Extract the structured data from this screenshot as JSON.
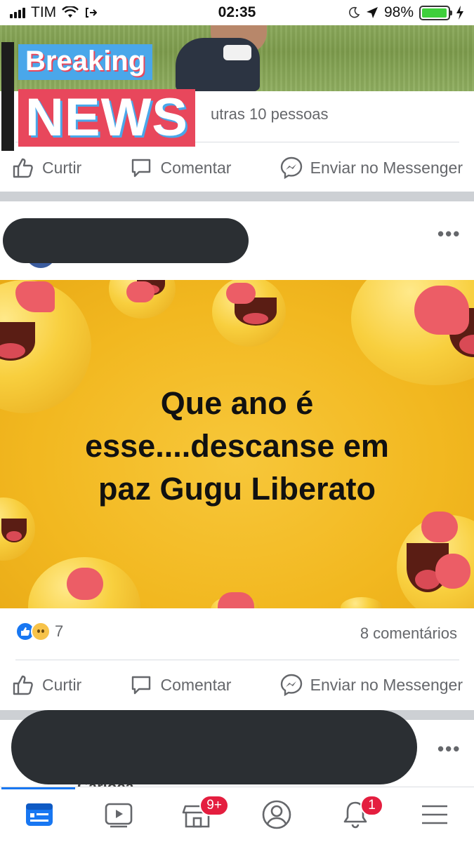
{
  "status_bar": {
    "carrier": "TIM",
    "time": "02:35",
    "battery_percent": "98%",
    "battery_level": 0.98,
    "icons": [
      "signal-icon",
      "wifi-icon",
      "call-forwarding-icon",
      "moon-icon",
      "location-arrow-icon",
      "battery-icon",
      "charging-icon"
    ]
  },
  "post1": {
    "overlay": {
      "top": "Breaking",
      "bottom": "NEWS"
    },
    "likes_text": "utras 10 pessoas",
    "actions": {
      "like": "Curtir",
      "comment": "Comentar",
      "messenger": "Enviar no Messenger"
    }
  },
  "post2": {
    "more": "•••",
    "image_text": [
      "Que ano é",
      "esse....descanse em",
      "paz Gugu Liberato"
    ],
    "reaction_count": "7",
    "comments": "8 comentários",
    "actions": {
      "like": "Curtir",
      "comment": "Comentar",
      "messenger": "Enviar no Messenger"
    }
  },
  "post3": {
    "more": "•••",
    "name_peek": "Carioca"
  },
  "tabbar": {
    "tabs": [
      "feed",
      "watch",
      "marketplace",
      "profile",
      "notifications",
      "menu"
    ],
    "marketplace_badge": "9+",
    "notifications_badge": "1"
  },
  "colors": {
    "facebook_blue": "#1877f2",
    "badge_red": "#e41e3f",
    "breaking_blue": "#4aa7ea",
    "breaking_red": "#e8475c",
    "image_yellow": "#f2b820"
  }
}
